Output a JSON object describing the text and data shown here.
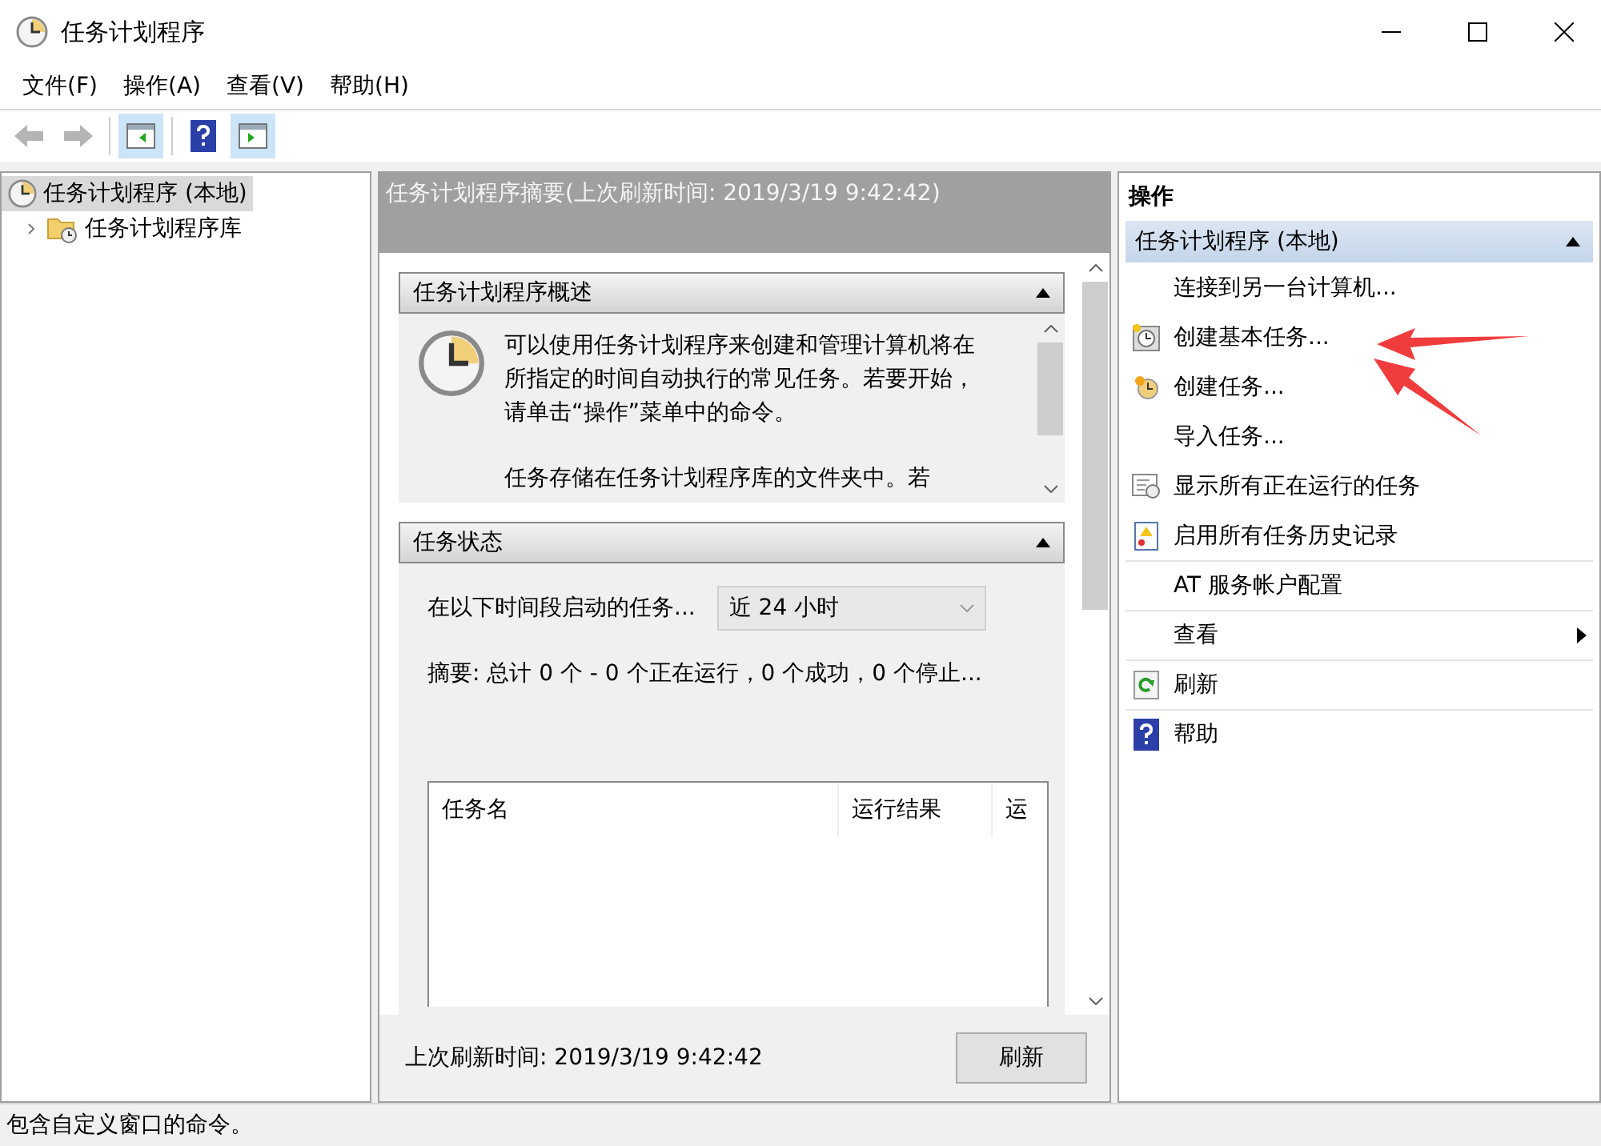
{
  "window": {
    "title": "任务计划程序"
  },
  "menu": [
    "文件(F)",
    "操作(A)",
    "查看(V)",
    "帮助(H)"
  ],
  "toolbar": [
    {
      "kind": "back",
      "disabled": true,
      "pressed": false
    },
    {
      "kind": "forward",
      "disabled": true,
      "pressed": false
    },
    {
      "kind": "tree-pane",
      "disabled": false,
      "pressed": true
    },
    {
      "kind": "help",
      "disabled": false,
      "pressed": false
    },
    {
      "kind": "action-pane",
      "disabled": false,
      "pressed": true
    }
  ],
  "tree": [
    {
      "label": "任务计划程序 (本地)",
      "selected": true,
      "children": [
        {
          "label": "任务计划程序库",
          "selected": false,
          "expanded": false
        }
      ]
    }
  ],
  "summary": {
    "header": "任务计划程序摘要(上次刷新时间: 2019/3/19 9:42:42)",
    "overview": {
      "title": "任务计划程序概述",
      "expanded": true,
      "paragraphs": [
        "可以使用任务计划程序来创建和管理计算机将在所指定的时间自动执行的常见任务。若要开始，请单击“操作”菜单中的命令。",
        "任务存储在任务计划程序库的文件夹中。若"
      ]
    },
    "status": {
      "title": "任务状态",
      "expanded": true,
      "period_label": "在以下时间段启动的任务...",
      "period_value": "近 24 小时",
      "summary_text": "摘要: 总计 0 个 - 0 个正在运行，0 个成功，0 个停止...",
      "columns": [
        "任务名",
        "运行结果",
        "运"
      ]
    },
    "last_refresh": "上次刷新时间: 2019/3/19 9:42:42",
    "refresh_button": "刷新"
  },
  "actions": {
    "title": "操作",
    "group": {
      "title": "任务计划程序 (本地)",
      "expanded": true
    },
    "items": [
      {
        "label": "连接到另一台计算机...",
        "kind": "none",
        "separator": false,
        "submenu": false
      },
      {
        "label": "创建基本任务...",
        "kind": "basic-task",
        "separator": false,
        "submenu": false
      },
      {
        "label": "创建任务...",
        "kind": "task",
        "separator": false,
        "submenu": false
      },
      {
        "label": "导入任务...",
        "kind": "none",
        "separator": false,
        "submenu": false
      },
      {
        "label": "显示所有正在运行的任务",
        "kind": "running",
        "separator": false,
        "submenu": false
      },
      {
        "label": "启用所有任务历史记录",
        "kind": "history",
        "separator": false,
        "submenu": false
      },
      {
        "label": "AT 服务帐户配置",
        "kind": "none",
        "separator": true,
        "submenu": false
      },
      {
        "label": "查看",
        "kind": "none",
        "separator": true,
        "submenu": true
      },
      {
        "label": "刷新",
        "kind": "refresh",
        "separator": true,
        "submenu": false
      },
      {
        "label": "帮助",
        "kind": "help",
        "separator": true,
        "submenu": false
      }
    ]
  },
  "status_bar": "包含自定义窗口的命令。"
}
